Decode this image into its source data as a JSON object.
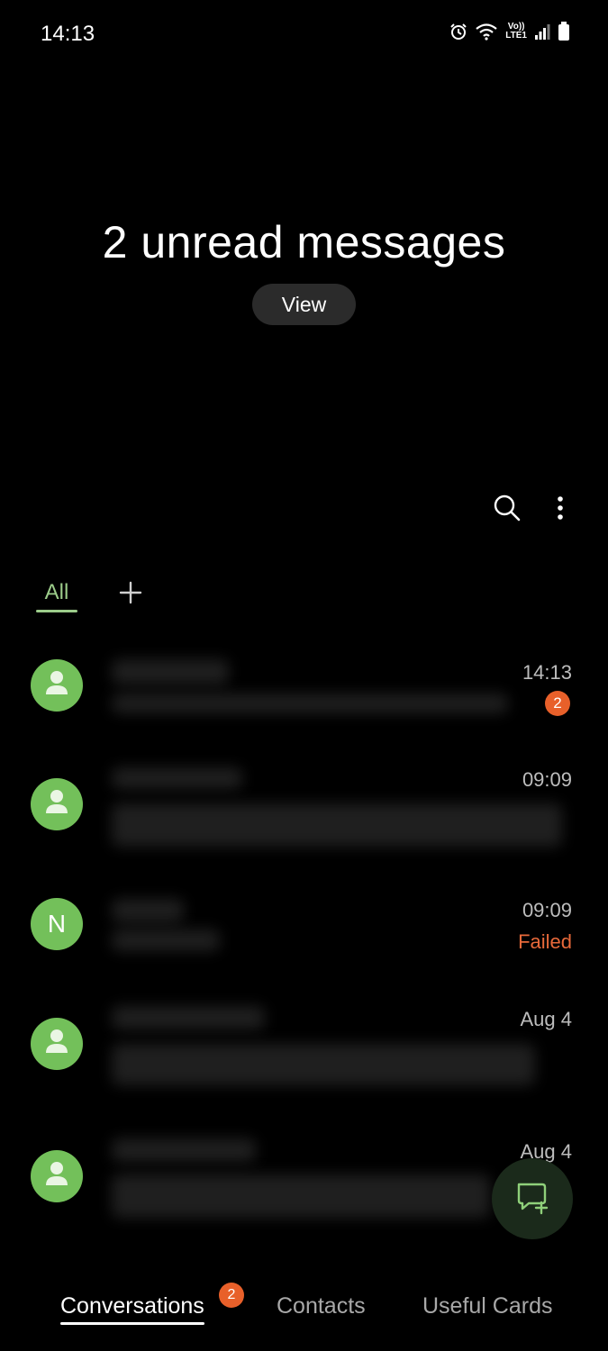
{
  "status_bar": {
    "time": "14:13",
    "icons": [
      "alarm-icon",
      "wifi-icon",
      "volte-icon",
      "signal-icon",
      "battery-icon"
    ],
    "volte_top": "Vo))",
    "volte_bottom": "LTE1"
  },
  "header": {
    "title": "2 unread messages",
    "view_label": "View"
  },
  "toolbar": {
    "search_icon": "search-icon",
    "more_icon": "more-vertical-icon"
  },
  "filters": {
    "active_label": "All",
    "add_icon": "plus-icon"
  },
  "conversations": [
    {
      "avatar": "person-icon",
      "time": "14:13",
      "unread_count": "2",
      "status": ""
    },
    {
      "avatar": "person-icon",
      "time": "09:09",
      "unread_count": "",
      "status": ""
    },
    {
      "avatar_letter": "N",
      "time": "09:09",
      "unread_count": "",
      "status": "Failed"
    },
    {
      "avatar": "person-icon",
      "time": "Aug 4",
      "unread_count": "",
      "status": ""
    },
    {
      "avatar": "person-icon",
      "time": "Aug 4",
      "unread_count": "",
      "status": ""
    }
  ],
  "fab": {
    "icon": "new-message-icon"
  },
  "bottom_nav": {
    "tabs": [
      {
        "label": "Conversations",
        "active": true,
        "badge": "2"
      },
      {
        "label": "Contacts",
        "active": false
      },
      {
        "label": "Useful Cards",
        "active": false
      }
    ]
  },
  "colors": {
    "background": "#000000",
    "accent_green": "#73c05a",
    "badge_orange": "#e8602a",
    "failed_orange": "#e8693a"
  }
}
